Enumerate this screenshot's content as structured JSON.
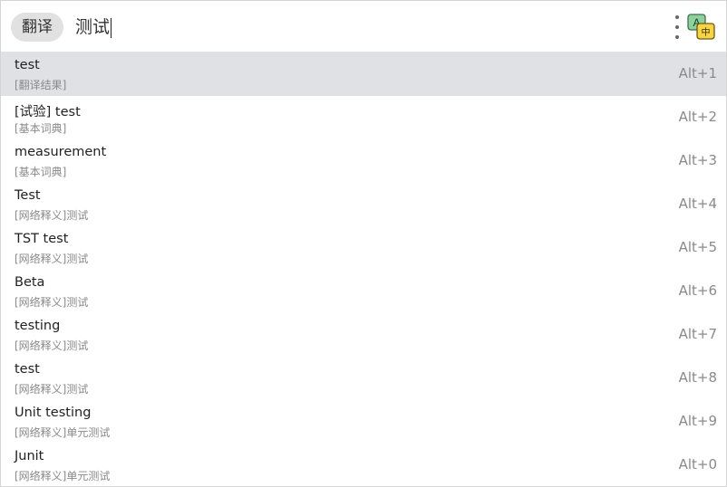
{
  "header": {
    "mode_label": "翻译",
    "query": "测试",
    "more_icon": "more-vertical-icon",
    "translate_icon": "translate-icon",
    "translate_icon_glyph_a": "A",
    "translate_icon_glyph_zh": "中"
  },
  "results": [
    {
      "title": "test",
      "subtitle": "[翻译结果]",
      "shortcut": "Alt+1"
    },
    {
      "title": "[试验] test",
      "subtitle": "[基本词典]",
      "shortcut": "Alt+2"
    },
    {
      "title": "measurement",
      "subtitle": "[基本词典]",
      "shortcut": "Alt+3"
    },
    {
      "title": "Test",
      "subtitle": "[网络释义]测试",
      "shortcut": "Alt+4"
    },
    {
      "title": "TST test",
      "subtitle": "[网络释义]测试",
      "shortcut": "Alt+5"
    },
    {
      "title": "Beta",
      "subtitle": "[网络释义]测试",
      "shortcut": "Alt+6"
    },
    {
      "title": "testing",
      "subtitle": "[网络释义]测试",
      "shortcut": "Alt+7"
    },
    {
      "title": "test",
      "subtitle": "[网络释义]测试",
      "shortcut": "Alt+8"
    },
    {
      "title": "Unit testing",
      "subtitle": "[网络释义]单元测试",
      "shortcut": "Alt+9"
    },
    {
      "title": "Junit",
      "subtitle": "[网络释义]单元测试",
      "shortcut": "Alt+0"
    }
  ],
  "colors": {
    "selected_row": "#dfe1e5",
    "pill": "#e1e1e1",
    "icon_green": "#8fd19e",
    "icon_yellow": "#f5d547"
  }
}
